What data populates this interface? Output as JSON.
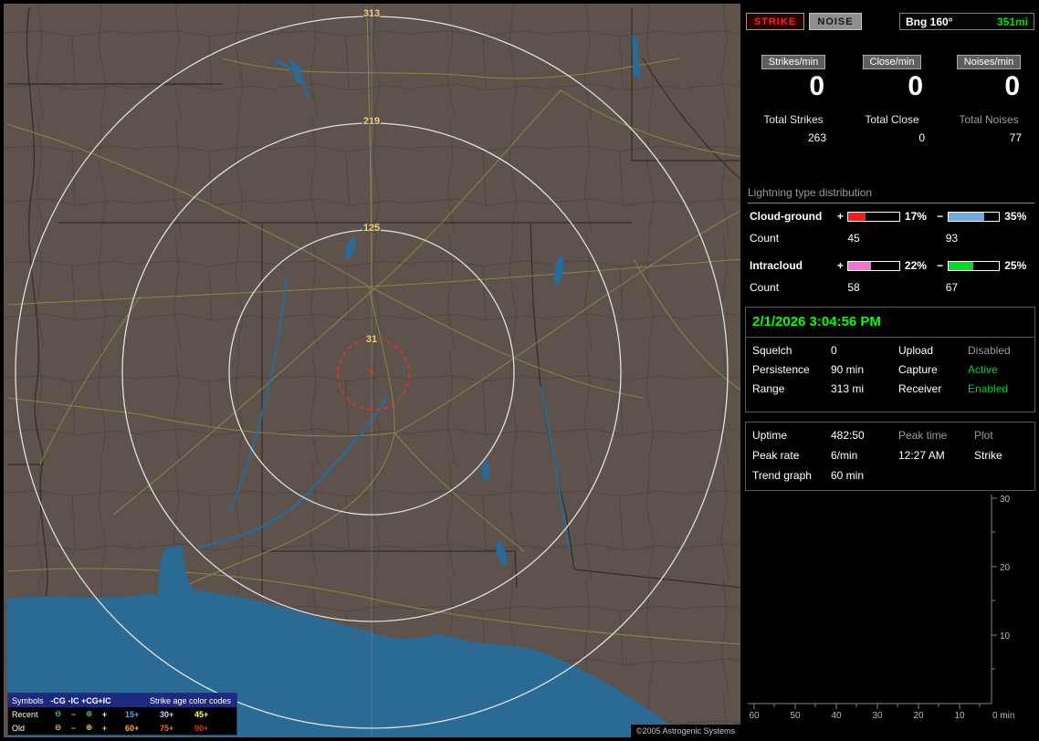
{
  "map": {
    "ring_labels": [
      "313",
      "219",
      "125",
      "31"
    ],
    "copyright": "©2005 Astrogenic Systems",
    "legend": {
      "symbols_label": "Symbols",
      "type_headers": [
        "-CG",
        "-IC",
        "+CG",
        "+IC"
      ],
      "age_title": "Strike age color codes",
      "rows": [
        {
          "label": "Recent",
          "symbols": [
            {
              "glyph": "⊖",
              "color": "#44cc77"
            },
            {
              "glyph": "−",
              "color": "#b0b0b0"
            },
            {
              "glyph": "⊕",
              "color": "#44cc77"
            },
            {
              "glyph": "+",
              "color": "#ffffff"
            }
          ],
          "ages": [
            {
              "text": "15+",
              "color": "#4da6ff"
            },
            {
              "text": "30+",
              "color": "#d0d0ff"
            },
            {
              "text": "45+",
              "color": "#ffff66"
            }
          ]
        },
        {
          "label": "Old",
          "symbols": [
            {
              "glyph": "⊖",
              "color": "#e0d24a"
            },
            {
              "glyph": "−",
              "color": "#b0b0b0"
            },
            {
              "glyph": "⊕",
              "color": "#e0d24a"
            },
            {
              "glyph": "+",
              "color": "#e0d24a"
            }
          ],
          "ages": [
            {
              "text": "60+",
              "color": "#ffaa33"
            },
            {
              "text": "75+",
              "color": "#ff6622"
            },
            {
              "text": "90+",
              "color": "#ff2222"
            }
          ]
        }
      ]
    }
  },
  "sidebar": {
    "toolbar": {
      "strike_label": "STRIKE",
      "noise_label": "NOISE",
      "bearing_label": "Bng 160°",
      "bearing_distance": "351mi"
    },
    "rates": [
      {
        "label": "Strikes/min",
        "value": "0",
        "total_label": "Total Strikes",
        "total_value": "263",
        "total_label_color": "#e8e8e8"
      },
      {
        "label": "Close/min",
        "value": "0",
        "total_label": "Total Close",
        "total_value": "0",
        "total_label_color": "#e8e8e8"
      },
      {
        "label": "Noises/min",
        "value": "0",
        "total_label": "Total Noises",
        "total_value": "77",
        "total_label_color": "#9a9a9a"
      }
    ],
    "distribution": {
      "title": "Lightning type distribution",
      "count_label": "Count",
      "rows": [
        {
          "label": "Cloud-ground",
          "plus_sign": "+",
          "minus_sign": "−",
          "plus_pct": "17%",
          "minus_pct": "35%",
          "plus_count": "45",
          "minus_count": "93",
          "plus_color": "#ff1a1a",
          "minus_color": "#6fa8e8",
          "plus_fill": "34%",
          "minus_fill": "70%"
        },
        {
          "label": "Intracloud",
          "plus_sign": "+",
          "minus_sign": "−",
          "plus_pct": "22%",
          "minus_pct": "25%",
          "plus_count": "58",
          "minus_count": "67",
          "plus_color": "#f075d0",
          "minus_color": "#00dd22",
          "plus_fill": "44%",
          "minus_fill": "50%"
        }
      ]
    },
    "status_panel": {
      "datetime": "2/1/2026 3:04:56 PM",
      "rows": [
        {
          "label1": "Squelch",
          "value1": "0",
          "label2": "Upload",
          "value2": "Disabled",
          "value2_color": "#9a9a9a"
        },
        {
          "label1": "Persistence",
          "value1": "90 min",
          "label2": "Capture",
          "value2": "Active",
          "value2_color": "#00cc33"
        },
        {
          "label1": "Range",
          "value1": "313 mi",
          "label2": "Receiver",
          "value2": "Enabled",
          "value2_color": "#00cc33"
        }
      ]
    },
    "stats_panel": {
      "uptime_label": "Uptime",
      "uptime_value": "482:50",
      "peak_rate_label": "Peak rate",
      "peak_rate_value": "6/min",
      "peak_time_label": "Peak time",
      "peak_time_value": "12:27 AM",
      "plot_label": "Plot",
      "plot_value": "Strike",
      "trend_label": "Trend graph",
      "trend_value": "60 min"
    }
  },
  "chart_data": {
    "type": "line",
    "title": "Trend graph",
    "window": "60 min",
    "xlabel": "min",
    "ylabel": "",
    "x_ticks": [
      60,
      50,
      40,
      30,
      20,
      10,
      0
    ],
    "y_ticks": [
      30,
      20,
      10
    ],
    "x_tick_labels": [
      "60",
      "50",
      "40",
      "30",
      "20",
      "10",
      "0 min"
    ],
    "y_tick_labels": [
      "30",
      "20",
      "10"
    ],
    "xlim": [
      60,
      0
    ],
    "ylim": [
      0,
      30
    ],
    "grid": false,
    "legend_position": "none",
    "series": [
      {
        "name": "Strike",
        "values": []
      }
    ]
  }
}
